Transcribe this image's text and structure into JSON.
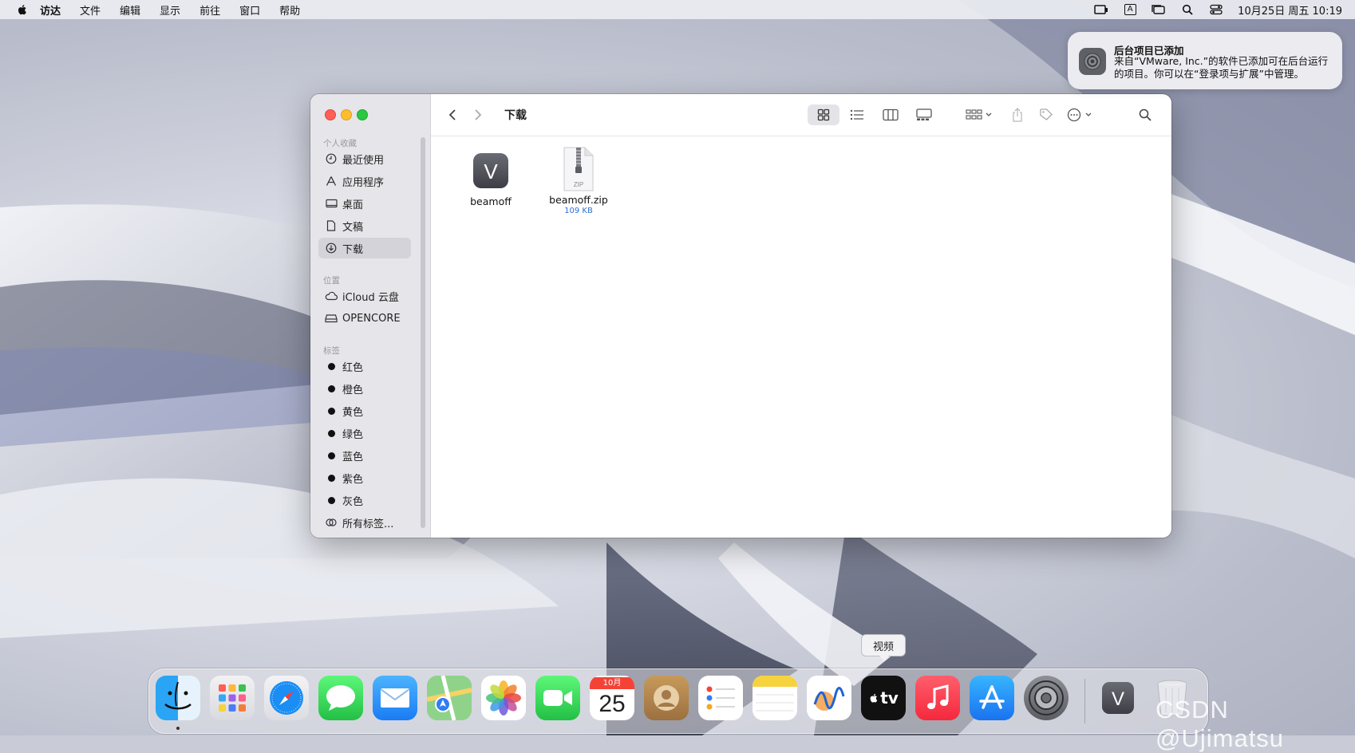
{
  "menubar": {
    "items": [
      "访达",
      "文件",
      "编辑",
      "显示",
      "前往",
      "窗口",
      "帮助"
    ],
    "datetime": "10月25日 周五  10:19",
    "input_icon_label": "A"
  },
  "notification": {
    "title": "后台项目已添加",
    "body": "来自“VMware, Inc.”的软件已添加可在后台运行的项目。你可以在“登录项与扩展”中管理。"
  },
  "finder": {
    "title": "下载",
    "sidebar": {
      "favorites_header": "个人收藏",
      "favorites": [
        "最近使用",
        "应用程序",
        "桌面",
        "文稿",
        "下载"
      ],
      "locations_header": "位置",
      "locations": [
        "iCloud 云盘",
        "OPENCORE"
      ],
      "tags_header": "标签",
      "tags": [
        "红色",
        "橙色",
        "黄色",
        "绿色",
        "蓝色",
        "紫色",
        "灰色"
      ],
      "all_tags": "所有标签..."
    },
    "files": [
      {
        "name": "beamoff",
        "icon_letter": "V"
      },
      {
        "name": "beamoff.zip",
        "size": "109 KB",
        "icon_label": "ZIP"
      }
    ]
  },
  "dock": {
    "tooltip": "视频",
    "calendar_month": "10月",
    "calendar_day": "25",
    "tv_label": "tv",
    "vmware_letter": "V"
  },
  "watermark": "CSDN @Ujimatsu"
}
